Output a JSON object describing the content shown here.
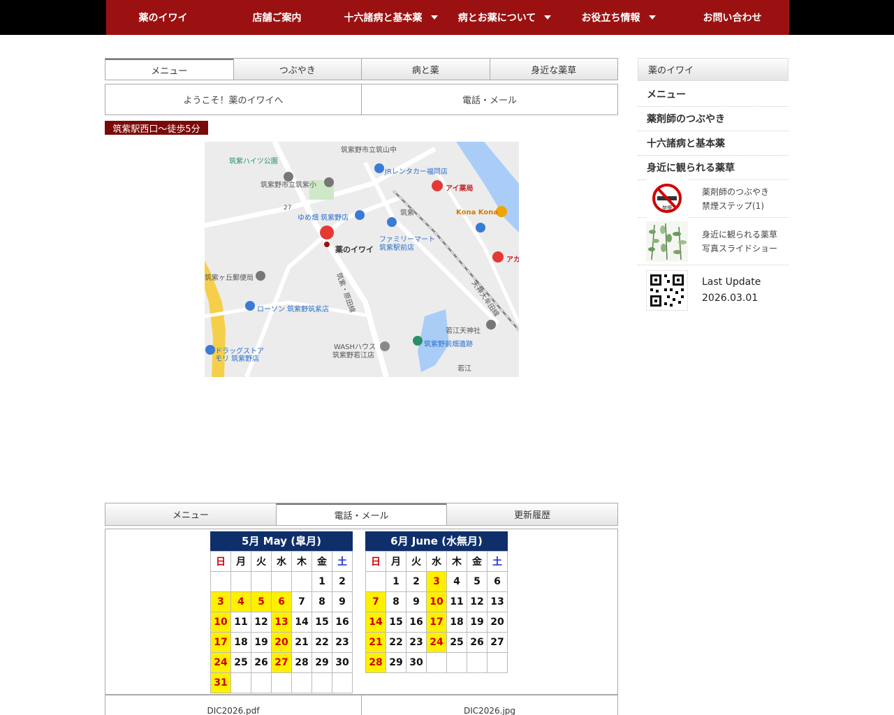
{
  "nav": {
    "items": [
      {
        "label": "薬のイワイ",
        "dropdown": false
      },
      {
        "label": "店舗ご案内",
        "dropdown": false
      },
      {
        "label": "十六諸病と基本薬",
        "dropdown": true
      },
      {
        "label": "病とお薬について",
        "dropdown": true
      },
      {
        "label": "お役立ち情報",
        "dropdown": true
      },
      {
        "label": "お問い合わせ",
        "dropdown": false
      }
    ]
  },
  "tabs_top": [
    "メニュー",
    "つぶやき",
    "病と薬",
    "身近な薬草"
  ],
  "welcome": {
    "left": "ようこそ！薬のイワイへ",
    "right": "電話・メール"
  },
  "station_badge": "筑紫駅西口～徒歩5分",
  "map": {
    "labels": {
      "school_north": "筑紫野市立筑山中",
      "park": "筑紫ハイツ公園",
      "rental": "JRレンタカー福岡店",
      "elementary": "筑紫野市立筑紫小",
      "pharmacy_ai": "アイ薬局",
      "kona": "Kona Kona",
      "station": "筑紫",
      "yume": "ゆめ畑 筑紫野店",
      "family": "ファミリーマート",
      "family2": "筑紫駅前店",
      "shop": "薬のイワイ",
      "post": "筑紫ヶ丘郵便局",
      "lawson": "ローソン 筑紫野筑紫店",
      "road": "天神大牟田線",
      "shrine": "若江天神社",
      "ruins": "筑紫野前畑遺跡",
      "wash": "WASHハウス",
      "wash2": "筑紫野若江店",
      "drug": "ドラッグストア",
      "drug2": "モリ 筑紫野店",
      "wakae": "若江",
      "akagi": "アカ",
      "street": "筑紫・原田線",
      "route": "27"
    }
  },
  "tabs_bottom": [
    "メニュー",
    "電話・メール",
    "更新履歴"
  ],
  "calendars": [
    {
      "title": "5月  May (皐月)",
      "weekdays": [
        "日",
        "月",
        "火",
        "水",
        "木",
        "金",
        "土"
      ],
      "weeks": [
        [
          "",
          "",
          "",
          "",
          "",
          "1",
          "2"
        ],
        [
          "3",
          "4",
          "5",
          "6",
          "7",
          "8",
          "9"
        ],
        [
          "10",
          "11",
          "12",
          "13",
          "14",
          "15",
          "16"
        ],
        [
          "17",
          "18",
          "19",
          "20",
          "21",
          "22",
          "23"
        ],
        [
          "24",
          "25",
          "26",
          "27",
          "28",
          "29",
          "30"
        ],
        [
          "31",
          "",
          "",
          "",
          "",
          "",
          ""
        ]
      ],
      "holidays": [
        "3",
        "4",
        "5",
        "6",
        "10",
        "13",
        "17",
        "20",
        "24",
        "27",
        "31"
      ]
    },
    {
      "title": "6月  June (水無月)",
      "weekdays": [
        "日",
        "月",
        "火",
        "水",
        "木",
        "金",
        "土"
      ],
      "weeks": [
        [
          "",
          "1",
          "2",
          "3",
          "4",
          "5",
          "6"
        ],
        [
          "7",
          "8",
          "9",
          "10",
          "11",
          "12",
          "13"
        ],
        [
          "14",
          "15",
          "16",
          "17",
          "18",
          "19",
          "20"
        ],
        [
          "21",
          "22",
          "23",
          "24",
          "25",
          "26",
          "27"
        ],
        [
          "28",
          "29",
          "30",
          "",
          "",
          "",
          ""
        ]
      ],
      "holidays": [
        "3",
        "7",
        "10",
        "14",
        "17",
        "21",
        "24",
        "28"
      ]
    }
  ],
  "files": [
    "DIC2026.pdf",
    "DIC2026.jpg"
  ],
  "sidebar": {
    "header": "薬のイワイ",
    "menu": [
      "メニュー",
      "薬剤師のつぶやき",
      "十六諸病と基本薬",
      "身近に観られる薬草"
    ],
    "cards": [
      {
        "line1": "薬剤師のつぶやき",
        "line2": "禁煙ステップ(1)",
        "icon": "no-smoking-icon",
        "sign_text": "禁煙"
      },
      {
        "line1": "身近に観られる薬草",
        "line2": "写真スライドショー",
        "icon": "herb-thumbnail"
      },
      {
        "line1": "Last Update",
        "line2": "2026.03.01",
        "icon": "qr-code-icon"
      }
    ]
  },
  "colors": {
    "nav_red": "#9b1111",
    "badge_red": "#7a0a0a",
    "calendar_navy": "#0f2f6b",
    "holiday_yellow": "#fff000"
  }
}
